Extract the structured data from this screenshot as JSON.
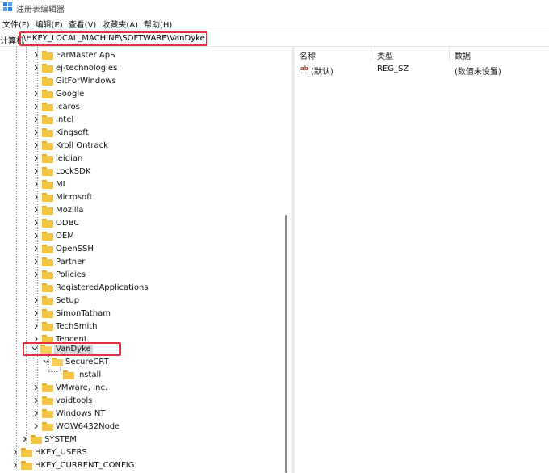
{
  "window": {
    "title": "注册表编辑器"
  },
  "menu": [
    "文件(F)",
    "编辑(E)",
    "查看(V)",
    "收藏夹(A)",
    "帮助(H)"
  ],
  "address": {
    "label": "计算机",
    "path": "\\HKEY_LOCAL_MACHINE\\SOFTWARE\\VanDyke"
  },
  "tree": {
    "software_children": [
      "EarMaster ApS",
      "ej-technologies",
      "GitForWindows",
      "Google",
      "Icaros",
      "Intel",
      "Kingsoft",
      "Kroll Ontrack",
      "leidian",
      "LockSDK",
      "MI",
      "Microsoft",
      "Mozilla",
      "ODBC",
      "OEM",
      "OpenSSH",
      "Partner",
      "Policies",
      "RegisteredApplications",
      "Setup",
      "SimonTatham",
      "TechSmith",
      "Tencent"
    ],
    "selected": "VanDyke",
    "vandyke_child": "SecureCRT",
    "securecrt_child": "Install",
    "after_vandyke": [
      "VMware, Inc.",
      "voidtools",
      "Windows NT",
      "WOW6432Node"
    ],
    "hklm_tail": "SYSTEM",
    "roots": [
      "HKEY_USERS",
      "HKEY_CURRENT_CONFIG"
    ]
  },
  "values_pane": {
    "headers": {
      "name": "名称",
      "type": "类型",
      "data": "数据"
    },
    "rows": [
      {
        "name": "(默认)",
        "type": "REG_SZ",
        "data": "(数值未设置)",
        "icon": "string-value-icon"
      }
    ]
  },
  "highlight_color": "#e2313e"
}
